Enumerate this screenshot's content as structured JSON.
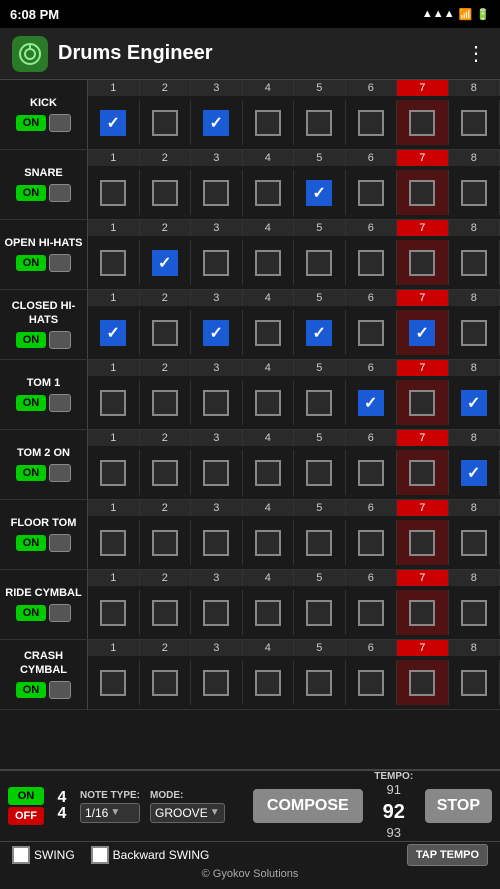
{
  "statusBar": {
    "time": "6:08 PM",
    "icons": "signal wifi battery"
  },
  "header": {
    "title": "Drums Engineer",
    "menuIcon": "⋮"
  },
  "drums": [
    {
      "name": "KICK",
      "steps": [
        false,
        false,
        false,
        false,
        false,
        false,
        false,
        false
      ],
      "checked": [
        true,
        false,
        true,
        false,
        false,
        false,
        false,
        false
      ]
    },
    {
      "name": "SNARE",
      "steps": [
        false,
        false,
        false,
        false,
        false,
        false,
        false,
        false
      ],
      "checked": [
        false,
        false,
        false,
        false,
        true,
        false,
        false,
        false
      ]
    },
    {
      "name": "OPEN HI-HATS",
      "steps": [
        false,
        false,
        false,
        false,
        false,
        false,
        false,
        false
      ],
      "checked": [
        false,
        true,
        false,
        false,
        false,
        false,
        false,
        false
      ]
    },
    {
      "name": "CLOSED HI-HATS",
      "steps": [
        false,
        false,
        false,
        false,
        false,
        false,
        false,
        false
      ],
      "checked": [
        true,
        false,
        true,
        false,
        true,
        false,
        true,
        false
      ]
    },
    {
      "name": "TOM 1",
      "steps": [
        false,
        false,
        false,
        false,
        false,
        false,
        false,
        false
      ],
      "checked": [
        false,
        false,
        false,
        false,
        false,
        true,
        false,
        true
      ]
    },
    {
      "name": "TOM 2 ON",
      "steps": [
        false,
        false,
        false,
        false,
        false,
        false,
        false,
        false
      ],
      "checked": [
        false,
        false,
        false,
        false,
        false,
        false,
        false,
        true
      ]
    },
    {
      "name": "FLOOR TOM",
      "steps": [
        false,
        false,
        false,
        false,
        false,
        false,
        false,
        false
      ],
      "checked": [
        false,
        false,
        false,
        false,
        false,
        false,
        false,
        false
      ]
    },
    {
      "name": "RIDE CYMBAL",
      "steps": [
        false,
        false,
        false,
        false,
        false,
        false,
        false,
        false
      ],
      "checked": [
        false,
        false,
        false,
        false,
        false,
        false,
        false,
        false
      ]
    },
    {
      "name": "CRASH CYMBAL",
      "steps": [
        false,
        false,
        false,
        false,
        false,
        false,
        false,
        false
      ],
      "checked": [
        false,
        false,
        false,
        false,
        false,
        false,
        false,
        false
      ]
    }
  ],
  "stepNumbers": [
    "1",
    "2",
    "3",
    "4",
    "5",
    "6",
    "7",
    "8"
  ],
  "footer": {
    "timeSig": {
      "top": "4",
      "bottom": "4"
    },
    "noteType": {
      "label": "NOTE TYPE:",
      "value": "1/16"
    },
    "mode": {
      "label": "MODE:",
      "value": "GROOVE"
    },
    "composeLabel": "COMPOSE",
    "tempo": {
      "label": "TEMPO:",
      "above": "91",
      "current": "92",
      "below": "93"
    },
    "stopLabel": "STOP",
    "swing": {
      "swingLabel": "SWING",
      "backwardLabel": "Backward SWING"
    },
    "tapTempoLabel": "TAP TEMPO",
    "copyright": "© Gyokov Solutions"
  }
}
